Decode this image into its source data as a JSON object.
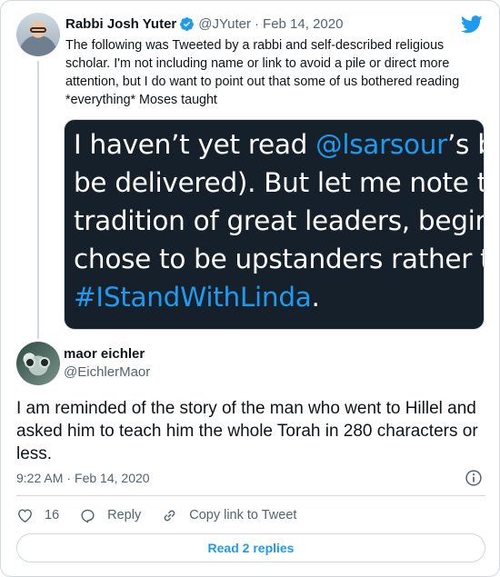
{
  "parent_tweet": {
    "author_name": "Rabbi Josh Yuter",
    "handle": "@JYuter",
    "separator": "·",
    "date": "Feb 14, 2020",
    "text": "The following was Tweeted by a rabbi and self-described religious scholar. I'm not including name or link to avoid a pile or direct more attention, but I do want to point out that some of us bothered reading *everything* Moses taught",
    "image_text": {
      "line1_a": "I haven’t yet read ",
      "line1_mention": "@lsarsour",
      "line1_b": "’s book (it won’t",
      "line2": "be delivered). But let me note that in the",
      "line3": "tradition of great leaders, beginning with",
      "line4": "chose to be upstanders rather than bysta",
      "line5_hashtag": "#IStandWithLinda",
      "line5_b": "."
    }
  },
  "tweet": {
    "author_name": "maor eichler",
    "handle": "@EichlerMaor",
    "text": "I am reminded of the story of the man who went to Hillel and asked him to teach him the whole Torah in 280 characters or less.",
    "time": "9:22 AM",
    "separator": "·",
    "date": "Feb 14, 2020"
  },
  "actions": {
    "like_count": "16",
    "reply_label": "Reply",
    "copy_link_label": "Copy link to Tweet"
  },
  "read_replies_label": "Read 2 replies",
  "icons": {
    "brand": "twitter-bird-icon",
    "verified": "verified-badge-icon",
    "info": "info-icon",
    "like": "heart-icon",
    "reply": "reply-bubble-icon",
    "copy_link": "link-icon"
  },
  "colors": {
    "accent": "#1d9bf0",
    "text": "#0f1419",
    "muted": "#536471",
    "border": "#cfd9de",
    "media_bg": "#15202b"
  }
}
